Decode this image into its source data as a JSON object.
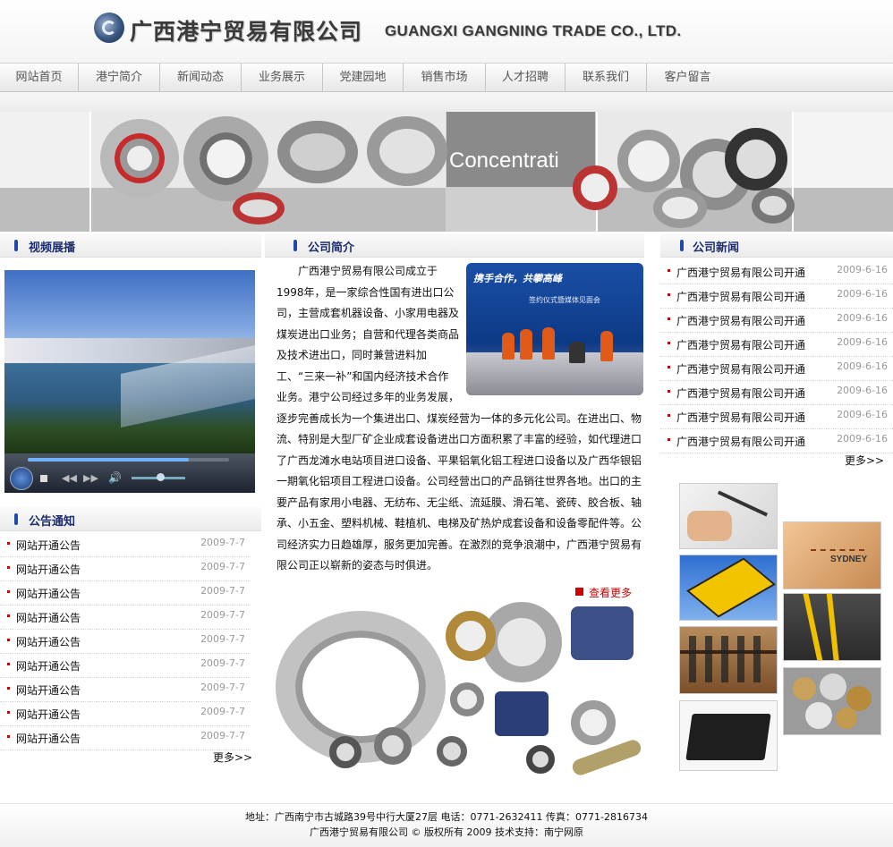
{
  "header": {
    "company_cn": "广西港宁贸易有限公司",
    "company_en": "GUANGXI GANGNING TRADE CO., LTD."
  },
  "nav": [
    {
      "label": "网站首页"
    },
    {
      "label": "港宁简介"
    },
    {
      "label": "新闻动态"
    },
    {
      "label": "业务展示"
    },
    {
      "label": "党建园地"
    },
    {
      "label": "销售市场"
    },
    {
      "label": "人才招聘"
    },
    {
      "label": "联系我们"
    },
    {
      "label": "客户留言"
    }
  ],
  "banner": {
    "text": "Concentrati"
  },
  "video": {
    "title": "视频展播"
  },
  "notice": {
    "title": "公告通知",
    "items": [
      {
        "text": "网站开通公告",
        "date": "2009-7-7"
      },
      {
        "text": "网站开通公告",
        "date": "2009-7-7"
      },
      {
        "text": "网站开通公告",
        "date": "2009-7-7"
      },
      {
        "text": "网站开通公告",
        "date": "2009-7-7"
      },
      {
        "text": "网站开通公告",
        "date": "2009-7-7"
      },
      {
        "text": "网站开通公告",
        "date": "2009-7-7"
      },
      {
        "text": "网站开通公告",
        "date": "2009-7-7"
      },
      {
        "text": "网站开通公告",
        "date": "2009-7-7"
      },
      {
        "text": "网站开通公告",
        "date": "2009-7-7"
      }
    ],
    "more": "更多>>"
  },
  "intro": {
    "title": "公司简介",
    "body": "广西港宁贸易有限公司成立于1998年，是一家综合性国有进出口公司，主营成套机器设备、小家用电器及煤炭进出口业务；自营和代理各类商品及技术进出口，同时兼营进料加工、“三来一补”和国内经济技术合作业务。港宁公司经过多年的业务发展，逐步完善成长为一个集进出口、煤炭经营为一体的多元化公司。在进出口、物流、特别是大型厂矿企业成套设备进出口方面积累了丰富的经验，如代理进口了广西龙滩水电站项目进口设备、平果铝氧化铝工程进口设备以及广西华银铝一期氧化铝项目工程进口设备。公司经营出口的产品销往世界各地。出口的主要产品有家用小电器、无纺布、无尘纸、流延膜、滑石笔、瓷砖、胶合板、轴承、小五金、塑料机械、鞋植机、电梯及矿热炉成套设备和设备零配件等。公司经济实力日趋雄厚，服务更加完善。在激烈的竞争浪潮中，广西港宁贸易有限公司正以崭新的姿态与时俱进。",
    "more": "查看更多",
    "photo_caption_1": "携手合作，共攀高峰",
    "photo_caption_2": "签约仪式暨媒体见面会"
  },
  "news": {
    "title": "公司新闻",
    "items": [
      {
        "text": "广西港宁贸易有限公司开通",
        "date": "2009-6-16"
      },
      {
        "text": "广西港宁贸易有限公司开通",
        "date": "2009-6-16"
      },
      {
        "text": "广西港宁贸易有限公司开通",
        "date": "2009-6-16"
      },
      {
        "text": "广西港宁贸易有限公司开通",
        "date": "2009-6-16"
      },
      {
        "text": "广西港宁贸易有限公司开通",
        "date": "2009-6-16"
      },
      {
        "text": "广西港宁贸易有限公司开通",
        "date": "2009-6-16"
      },
      {
        "text": "广西港宁贸易有限公司开通",
        "date": "2009-6-16"
      },
      {
        "text": "广西港宁贸易有限公司开通",
        "date": "2009-6-16"
      }
    ],
    "more": "更多>>"
  },
  "footer": {
    "line1": "地址：广西南宁市古城路39号中行大厦27层 电话：0771-2632411 传真：0771-2816734",
    "line2": "广西港宁贸易有限公司 © 版权所有 2009 技术支持：南宁网原"
  },
  "colors": {
    "accent": "#1d2d6c",
    "dot": "#cc0000",
    "nav_text": "#555555"
  }
}
